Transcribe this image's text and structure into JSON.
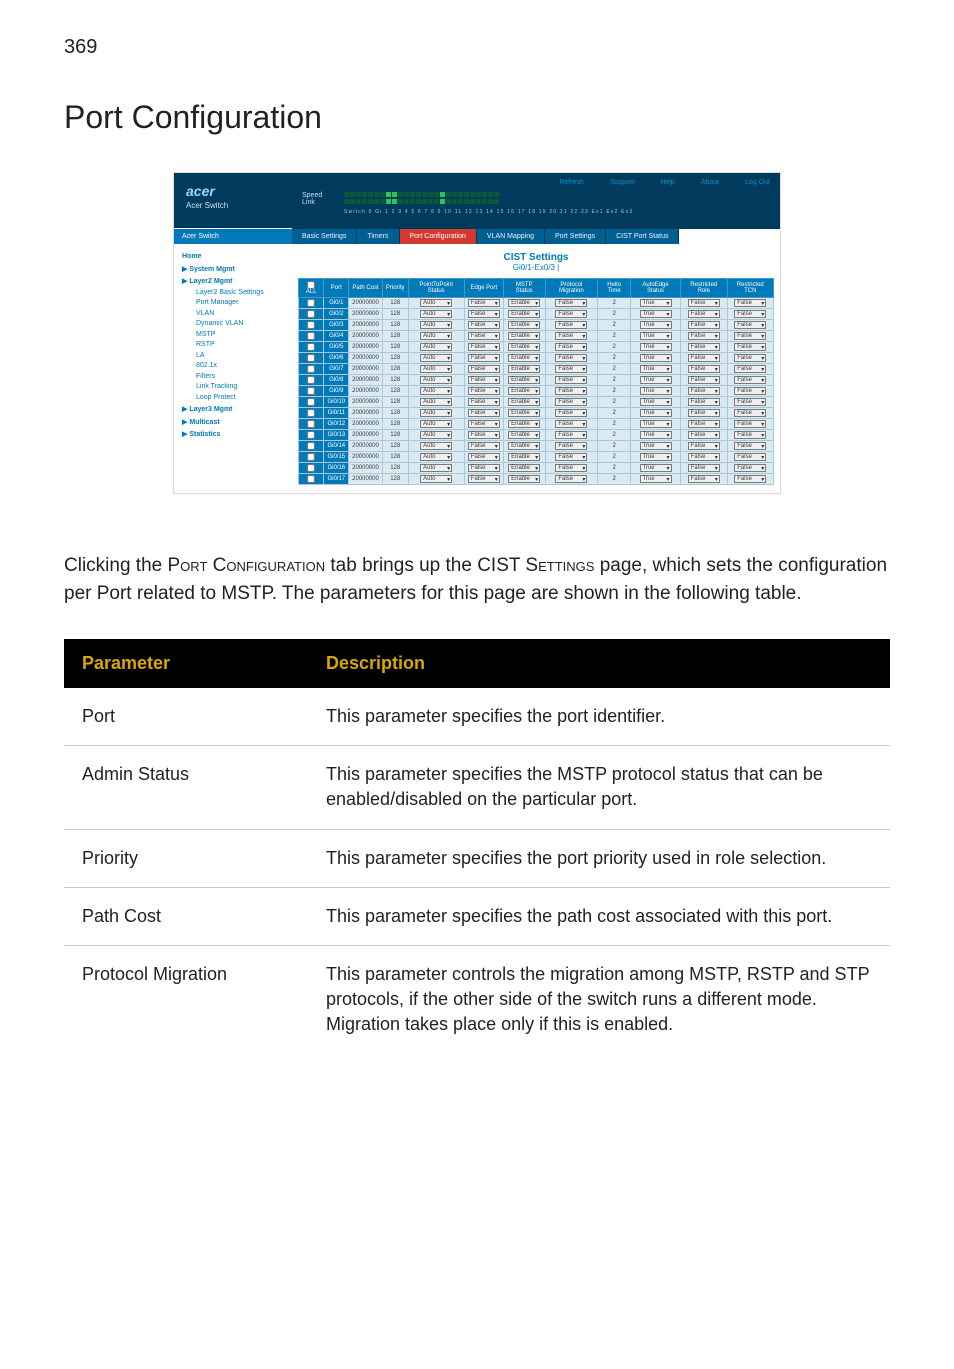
{
  "page_number": "369",
  "title": "Port Configuration",
  "intro_html": "Clicking the PORT CONFIGURATION tab brings up the CIST SETTINGS page, which sets the configuration per Port related to MSTP. The parameters for this page are shown in the following table.",
  "screenshot": {
    "brand_logo": "acer",
    "brand_sub": "Acer Switch",
    "util_links": [
      "Refresh",
      "Support",
      "Help",
      "About",
      "Log Out"
    ],
    "speed_label": "Speed",
    "link_label": "Link",
    "port_numbers": "Switch 0 Gi 1  2  3  4  5  6  7  8  9 10 11 12 13 14 15 16 17 18 19 20 21 22 23 Ex1 Ex2 Ex3",
    "side_tab": "Acer Switch",
    "tabs": [
      "Basic Settings",
      "Timers",
      "Port Configuration",
      "VLAN Mapping",
      "Port Settings",
      "CIST Port Status"
    ],
    "active_tab": 2,
    "nav": {
      "home": "Home",
      "groups": [
        {
          "title": "System Mgmt",
          "items": []
        },
        {
          "title": "Layer2 Mgmt",
          "items": [
            "Layer2 Basic Settings",
            "Port Manager",
            "VLAN",
            "Dynamic VLAN",
            "MSTP",
            "RSTP",
            "LA",
            "802.1x",
            "Filters",
            "Link Tracking",
            "Loop Protect"
          ]
        },
        {
          "title": "Layer3 Mgmt",
          "items": []
        },
        {
          "title": "Multicast",
          "items": []
        },
        {
          "title": "Statistics",
          "items": []
        }
      ]
    },
    "main_heading": "CIST Settings",
    "main_sub": "Gi0/1-Ex0/3 |",
    "columns": [
      "ALL",
      "Port",
      "Path Cost",
      "Priority",
      "PointToPoint Status",
      "Edge Port",
      "MSTP Status",
      "Protocol Migration",
      "Hello Time",
      "AutoEdge Status",
      "Restricted Role",
      "Restricted TCN"
    ],
    "rows": [
      {
        "port": "Gi0/1",
        "cost": "20000000",
        "prio": "128",
        "p2p": "Auto",
        "edge": "False",
        "mstp": "Enable",
        "mig": "False",
        "hello": "2",
        "auto": "True",
        "rrole": "False",
        "rtcn": "False"
      },
      {
        "port": "Gi0/2",
        "cost": "20000000",
        "prio": "128",
        "p2p": "Auto",
        "edge": "False",
        "mstp": "Enable",
        "mig": "False",
        "hello": "2",
        "auto": "True",
        "rrole": "False",
        "rtcn": "False"
      },
      {
        "port": "Gi0/3",
        "cost": "20000000",
        "prio": "128",
        "p2p": "Auto",
        "edge": "False",
        "mstp": "Enable",
        "mig": "False",
        "hello": "2",
        "auto": "True",
        "rrole": "False",
        "rtcn": "False"
      },
      {
        "port": "Gi0/4",
        "cost": "20000000",
        "prio": "128",
        "p2p": "Auto",
        "edge": "False",
        "mstp": "Enable",
        "mig": "False",
        "hello": "2",
        "auto": "True",
        "rrole": "False",
        "rtcn": "False"
      },
      {
        "port": "Gi0/5",
        "cost": "20000000",
        "prio": "128",
        "p2p": "Auto",
        "edge": "False",
        "mstp": "Enable",
        "mig": "False",
        "hello": "2",
        "auto": "True",
        "rrole": "False",
        "rtcn": "False"
      },
      {
        "port": "Gi0/6",
        "cost": "20000000",
        "prio": "128",
        "p2p": "Auto",
        "edge": "False",
        "mstp": "Enable",
        "mig": "False",
        "hello": "2",
        "auto": "True",
        "rrole": "False",
        "rtcn": "False"
      },
      {
        "port": "Gi0/7",
        "cost": "20000000",
        "prio": "128",
        "p2p": "Auto",
        "edge": "False",
        "mstp": "Enable",
        "mig": "False",
        "hello": "2",
        "auto": "True",
        "rrole": "False",
        "rtcn": "False"
      },
      {
        "port": "Gi0/8",
        "cost": "20000000",
        "prio": "128",
        "p2p": "Auto",
        "edge": "False",
        "mstp": "Enable",
        "mig": "False",
        "hello": "2",
        "auto": "True",
        "rrole": "False",
        "rtcn": "False"
      },
      {
        "port": "Gi0/9",
        "cost": "20000000",
        "prio": "128",
        "p2p": "Auto",
        "edge": "False",
        "mstp": "Enable",
        "mig": "False",
        "hello": "2",
        "auto": "True",
        "rrole": "False",
        "rtcn": "False"
      },
      {
        "port": "Gi0/10",
        "cost": "20000000",
        "prio": "128",
        "p2p": "Auto",
        "edge": "False",
        "mstp": "Enable",
        "mig": "False",
        "hello": "2",
        "auto": "True",
        "rrole": "False",
        "rtcn": "False"
      },
      {
        "port": "Gi0/11",
        "cost": "20000000",
        "prio": "128",
        "p2p": "Auto",
        "edge": "False",
        "mstp": "Enable",
        "mig": "False",
        "hello": "2",
        "auto": "True",
        "rrole": "False",
        "rtcn": "False"
      },
      {
        "port": "Gi0/12",
        "cost": "20000000",
        "prio": "128",
        "p2p": "Auto",
        "edge": "False",
        "mstp": "Enable",
        "mig": "False",
        "hello": "2",
        "auto": "True",
        "rrole": "False",
        "rtcn": "False"
      },
      {
        "port": "Gi0/13",
        "cost": "20000000",
        "prio": "128",
        "p2p": "Auto",
        "edge": "False",
        "mstp": "Enable",
        "mig": "False",
        "hello": "2",
        "auto": "True",
        "rrole": "False",
        "rtcn": "False"
      },
      {
        "port": "Gi0/14",
        "cost": "20000000",
        "prio": "128",
        "p2p": "Auto",
        "edge": "False",
        "mstp": "Enable",
        "mig": "False",
        "hello": "2",
        "auto": "True",
        "rrole": "False",
        "rtcn": "False"
      },
      {
        "port": "Gi0/15",
        "cost": "20000000",
        "prio": "128",
        "p2p": "Auto",
        "edge": "False",
        "mstp": "Enable",
        "mig": "False",
        "hello": "2",
        "auto": "True",
        "rrole": "False",
        "rtcn": "False"
      },
      {
        "port": "Gi0/16",
        "cost": "20000000",
        "prio": "128",
        "p2p": "Auto",
        "edge": "False",
        "mstp": "Enable",
        "mig": "False",
        "hello": "2",
        "auto": "True",
        "rrole": "False",
        "rtcn": "False"
      },
      {
        "port": "Gi0/17",
        "cost": "20000000",
        "prio": "128",
        "p2p": "Auto",
        "edge": "False",
        "mstp": "Enable",
        "mig": "False",
        "hello": "2",
        "auto": "True",
        "rrole": "False",
        "rtcn": "False"
      }
    ]
  },
  "params_table": {
    "headers": [
      "Parameter",
      "Description"
    ],
    "rows": [
      {
        "name": "Port",
        "desc": "This parameter specifies the port identifier."
      },
      {
        "name": "Admin Status",
        "desc": "This parameter specifies the MSTP protocol status that can be enabled/disabled on the particular port."
      },
      {
        "name": "Priority",
        "desc": "This parameter specifies the port priority used in role selection."
      },
      {
        "name": "Path Cost",
        "desc": "This parameter specifies the path cost associated with this port."
      },
      {
        "name": "Protocol Migration",
        "desc": "This parameter controls the migration among MSTP, RSTP and STP protocols, if the other side of the switch runs a different mode. Migration takes place only if this is enabled."
      }
    ]
  }
}
